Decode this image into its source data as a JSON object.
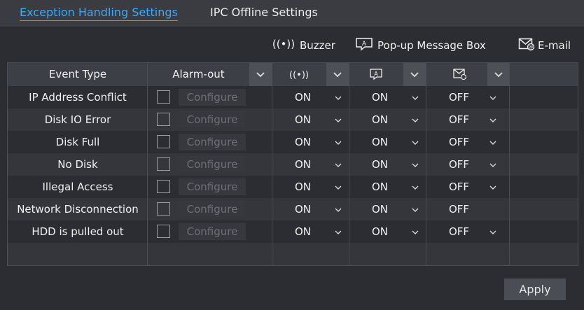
{
  "tabs": [
    {
      "label": "Exception Handling Settings",
      "active": true
    },
    {
      "label": "IPC Offline Settings",
      "active": false
    }
  ],
  "legend": {
    "buzzer": "Buzzer",
    "popup": "Pop-up Message Box",
    "email": "E-mail"
  },
  "table": {
    "headers": {
      "event_type": "Event Type",
      "alarm_out": "Alarm-out"
    },
    "configure_label": "Configure",
    "rows": [
      {
        "event": "IP Address Conflict",
        "buzzer": "ON",
        "popup": "ON",
        "email": "OFF",
        "email_dropdown": true
      },
      {
        "event": "Disk IO Error",
        "buzzer": "ON",
        "popup": "ON",
        "email": "OFF",
        "email_dropdown": true
      },
      {
        "event": "Disk Full",
        "buzzer": "ON",
        "popup": "ON",
        "email": "OFF",
        "email_dropdown": true
      },
      {
        "event": "No Disk",
        "buzzer": "ON",
        "popup": "ON",
        "email": "OFF",
        "email_dropdown": true
      },
      {
        "event": "Illegal Access",
        "buzzer": "ON",
        "popup": "ON",
        "email": "OFF",
        "email_dropdown": true
      },
      {
        "event": "Network Disconnection",
        "buzzer": "ON",
        "popup": "ON",
        "email": "OFF",
        "email_dropdown": false
      },
      {
        "event": "HDD is pulled out",
        "buzzer": "ON",
        "popup": "ON",
        "email": "OFF",
        "email_dropdown": true
      }
    ]
  },
  "apply_label": "Apply",
  "colors": {
    "accent": "#3ea8f5",
    "background": "#2b2d32",
    "tabbar": "#3a3c42",
    "header": "#3c3f45"
  }
}
